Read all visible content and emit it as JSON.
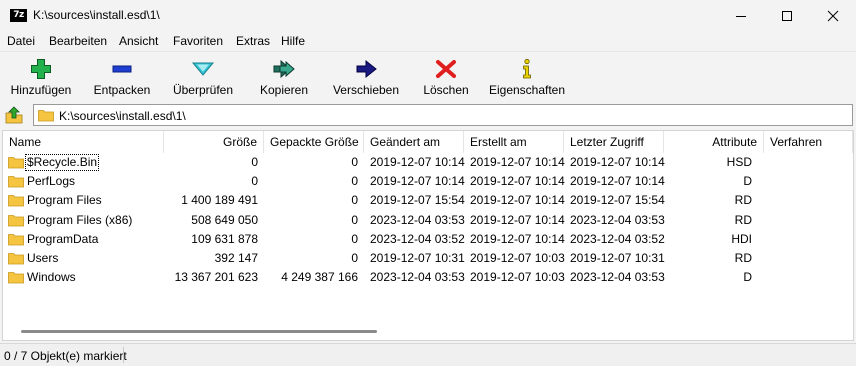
{
  "window": {
    "title": "K:\\sources\\install.esd\\1\\",
    "app_icon_text": "7z"
  },
  "menu": [
    "Datei",
    "Bearbeiten",
    "Ansicht",
    "Favoriten",
    "Extras",
    "Hilfe"
  ],
  "toolbar": {
    "add": "Hinzufügen",
    "extract": "Entpacken",
    "test": "Überprüfen",
    "copy": "Kopieren",
    "move": "Verschieben",
    "delete": "Löschen",
    "info": "Eigenschaften"
  },
  "address": {
    "path": "K:\\sources\\install.esd\\1\\"
  },
  "columns": {
    "name": "Name",
    "size": "Größe",
    "packed": "Gepackte Größe",
    "modified": "Geändert am",
    "created": "Erstellt am",
    "accessed": "Letzter Zugriff",
    "attributes": "Attribute",
    "method": "Verfahren"
  },
  "rows": [
    {
      "name": "$Recycle.Bin",
      "size": "0",
      "packed": "0",
      "modified": "2019-12-07 10:14",
      "created": "2019-12-07 10:14",
      "accessed": "2019-12-07 10:14",
      "attributes": "HSD",
      "method": ""
    },
    {
      "name": "PerfLogs",
      "size": "0",
      "packed": "0",
      "modified": "2019-12-07 10:14",
      "created": "2019-12-07 10:14",
      "accessed": "2019-12-07 10:14",
      "attributes": "D",
      "method": ""
    },
    {
      "name": "Program Files",
      "size": "1 400 189 491",
      "packed": "0",
      "modified": "2019-12-07 15:54",
      "created": "2019-12-07 10:14",
      "accessed": "2019-12-07 15:54",
      "attributes": "RD",
      "method": ""
    },
    {
      "name": "Program Files (x86)",
      "size": "508 649 050",
      "packed": "0",
      "modified": "2023-12-04 03:53",
      "created": "2019-12-07 10:14",
      "accessed": "2023-12-04 03:53",
      "attributes": "RD",
      "method": ""
    },
    {
      "name": "ProgramData",
      "size": "109 631 878",
      "packed": "0",
      "modified": "2023-12-04 03:52",
      "created": "2019-12-07 10:14",
      "accessed": "2023-12-04 03:52",
      "attributes": "HDI",
      "method": ""
    },
    {
      "name": "Users",
      "size": "392 147",
      "packed": "0",
      "modified": "2019-12-07 10:31",
      "created": "2019-12-07 10:03",
      "accessed": "2019-12-07 10:31",
      "attributes": "RD",
      "method": ""
    },
    {
      "name": "Windows",
      "size": "13 367 201 623",
      "packed": "4 249 387 166",
      "modified": "2023-12-04 03:53",
      "created": "2019-12-07 10:03",
      "accessed": "2023-12-04 03:53",
      "attributes": "D",
      "method": ""
    }
  ],
  "status": {
    "selection": "0 / 7 Objekt(e) markiert"
  },
  "colors": {
    "folder": "#f5c542",
    "add_icon": "#22b14c",
    "extract_icon": "#1e3fd1",
    "test_icon": "#35c6d6",
    "delete_icon": "#e01e1e",
    "info_icon": "#e8d200"
  }
}
